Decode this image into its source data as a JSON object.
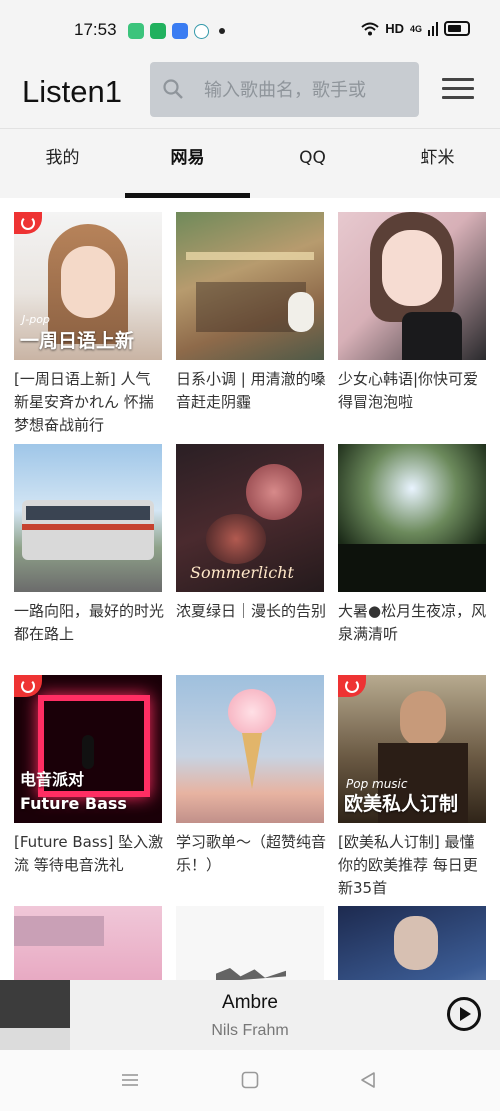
{
  "status": {
    "time": "17:53",
    "network": "HD",
    "signal": "4G"
  },
  "header": {
    "title": "Listen1",
    "search_placeholder": "输入歌曲名，歌手或"
  },
  "tabs": [
    {
      "label": "我的"
    },
    {
      "label": "网易"
    },
    {
      "label": "QQ"
    },
    {
      "label": "虾米"
    }
  ],
  "playlists": [
    {
      "title": "[一周日语上新] 人气新星安斉かれん 怀揣梦想奋战前行",
      "cover_text": "一周日语上新",
      "cover_sub": "J-pop"
    },
    {
      "title": "日系小调 | 用清澈的嗓音赶走阴霾"
    },
    {
      "title": "少女心韩语|你快可爱得冒泡泡啦"
    },
    {
      "title": "一路向阳，最好的时光都在路上"
    },
    {
      "title": "浓夏绿日｜漫长的告别",
      "cover_text": "Sommerlicht"
    },
    {
      "title": "大暑●松月生夜凉，风泉满清听"
    },
    {
      "title": "[Future Bass] 坠入激流 等待电音洗礼",
      "cover_text_1": "电音派对",
      "cover_text_2": "Future Bass"
    },
    {
      "title": "学习歌单～（超赞纯音乐！）"
    },
    {
      "title": "[欧美私人订制] 最懂你的欧美推荐 每日更新35首",
      "cover_text": "欧美私人订制",
      "cover_sub": "Pop music"
    },
    {
      "title": ""
    },
    {
      "title": ""
    },
    {
      "title": ""
    }
  ],
  "player": {
    "track": "Ambre",
    "artist": "Nils Frahm"
  }
}
